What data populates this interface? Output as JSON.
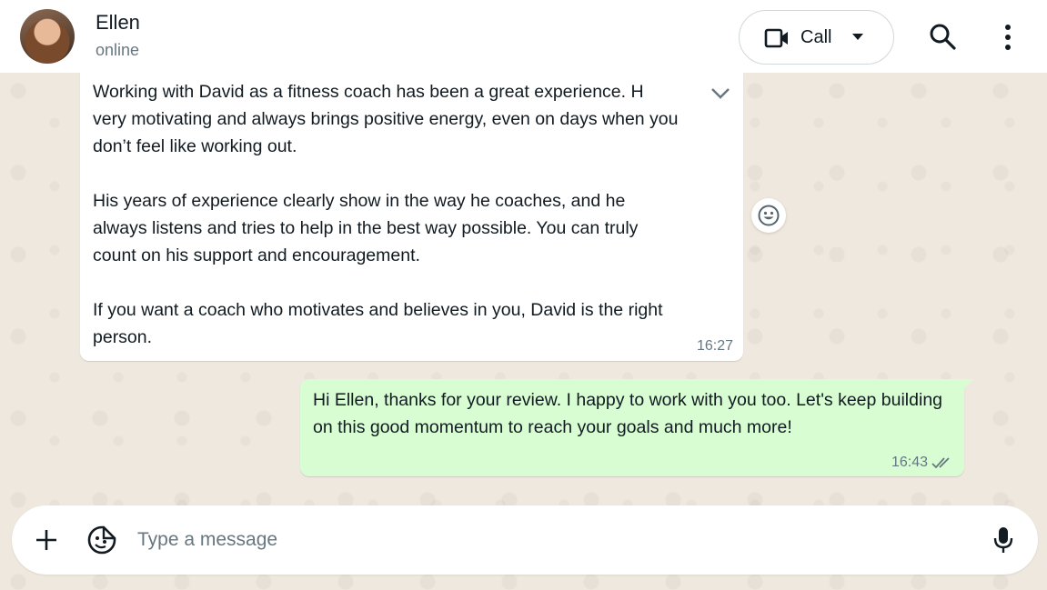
{
  "header": {
    "name": "Ellen",
    "status": "online",
    "call_label": "Call"
  },
  "messages": {
    "incoming": {
      "text": "Working with David as a fitness coach has been a great experience. H\nvery motivating and always brings positive energy, even on days when you\ndon’t feel like working out.\n\nHis years of experience clearly show in the way he coaches, and he\nalways listens and tries to help in the best way possible. You can truly\ncount on his support and encouragement.\n\nIf you want a coach who motivates and believes in you, David is the right\nperson.",
      "time": "16:27"
    },
    "outgoing": {
      "text": "Hi Ellen, thanks for your review. I happy to work with you too. Let's keep building on this good momentum to reach your goals and much more!",
      "time": "16:43"
    }
  },
  "composer": {
    "placeholder": "Type a message"
  },
  "colors": {
    "outgoing_bubble": "#d9fdd3",
    "incoming_bubble": "#ffffff",
    "wallpaper": "#efe8de",
    "secondary_text": "#667781"
  },
  "icons": [
    "video-camera-icon",
    "chevron-down-icon",
    "search-icon",
    "kebab-menu-icon",
    "message-dropdown-icon",
    "emoji-reaction-icon",
    "double-check-icon",
    "plus-icon",
    "sticker-icon",
    "microphone-icon"
  ]
}
